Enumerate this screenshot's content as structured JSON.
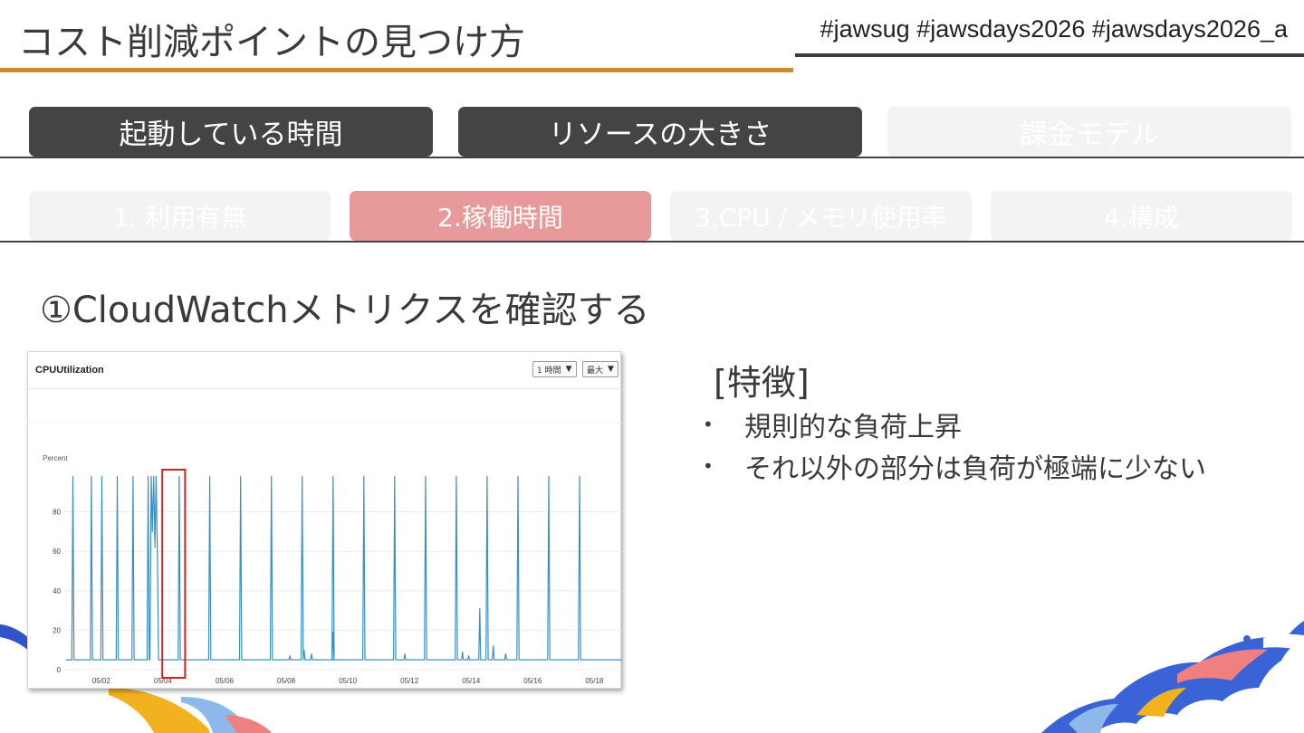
{
  "slide": {
    "title": "コスト削減ポイントの見つけ方",
    "hashtags": "#jawsug #jawsdays2026 #jawsdays2026_a"
  },
  "tabs": [
    {
      "label": "起動している時間",
      "active": true
    },
    {
      "label": "リソースの大きさ",
      "active": true
    },
    {
      "label": "課金モデル",
      "active": false
    }
  ],
  "steps": [
    {
      "label": "1. 利用有無",
      "active": false
    },
    {
      "label": "2.稼働時間",
      "active": true
    },
    {
      "label": "3.CPU / メモリ使用率",
      "active": false
    },
    {
      "label": "4.構成",
      "active": false
    }
  ],
  "section_heading": "①CloudWatchメトリクスを確認する",
  "metric_widget": {
    "title": "CPUUtilization",
    "period_select": "1 時間",
    "stat_select": "最大",
    "unit_label": "Percent"
  },
  "features": {
    "title": "[特徴]",
    "items": [
      "規則的な負荷上昇",
      "それ以外の部分は負荷が極端に少ない"
    ]
  },
  "colors": {
    "title_underline": "#c98b2c",
    "active_tab": "#444444",
    "active_step": "#e89a9a",
    "line_series": "#3b8fc4",
    "highlight_box": "#d42020"
  },
  "chart_data": {
    "type": "line",
    "title": "CPUUtilization",
    "ylabel": "Percent",
    "ylim": [
      0,
      100
    ],
    "y_ticks": [
      0,
      20,
      40,
      60,
      80
    ],
    "x_ticks": [
      "05/02",
      "05/04",
      "05/06",
      "05/08",
      "05/10",
      "05/12",
      "05/14",
      "05/16",
      "05/18"
    ],
    "x_tick_days": [
      2,
      4,
      6,
      8,
      10,
      12,
      14,
      16,
      18
    ],
    "xlim_days": [
      0.8,
      18.9
    ],
    "baseline": 5,
    "spikes": [
      {
        "day": 1.08,
        "value": 98
      },
      {
        "day": 1.68,
        "value": 98
      },
      {
        "day": 2.02,
        "value": 98
      },
      {
        "day": 2.52,
        "value": 98
      },
      {
        "day": 3.03,
        "value": 98
      },
      {
        "day": 3.52,
        "value": 98
      },
      {
        "day": 4.53,
        "value": 98
      },
      {
        "day": 5.52,
        "value": 98
      },
      {
        "day": 6.52,
        "value": 98
      },
      {
        "day": 7.52,
        "value": 98
      },
      {
        "day": 8.52,
        "value": 98
      },
      {
        "day": 9.52,
        "value": 98
      },
      {
        "day": 10.52,
        "value": 98
      },
      {
        "day": 11.52,
        "value": 98
      },
      {
        "day": 12.52,
        "value": 98
      },
      {
        "day": 13.52,
        "value": 98
      },
      {
        "day": 14.52,
        "value": 98
      },
      {
        "day": 15.52,
        "value": 98
      },
      {
        "day": 16.52,
        "value": 98
      },
      {
        "day": 17.52,
        "value": 98
      }
    ],
    "burst": [
      {
        "day": 3.58,
        "value": 5
      },
      {
        "day": 3.62,
        "value": 98
      },
      {
        "day": 3.66,
        "value": 70
      },
      {
        "day": 3.7,
        "value": 98
      },
      {
        "day": 3.74,
        "value": 62
      },
      {
        "day": 3.78,
        "value": 98
      },
      {
        "day": 3.82,
        "value": 60
      },
      {
        "day": 3.86,
        "value": 5
      }
    ],
    "bumps": [
      {
        "day": 8.12,
        "value": 7
      },
      {
        "day": 8.58,
        "value": 10
      },
      {
        "day": 8.82,
        "value": 8
      },
      {
        "day": 9.52,
        "value": 19
      },
      {
        "day": 11.85,
        "value": 8
      },
      {
        "day": 13.72,
        "value": 9
      },
      {
        "day": 13.92,
        "value": 7
      },
      {
        "day": 14.28,
        "value": 31
      },
      {
        "day": 14.72,
        "value": 12
      },
      {
        "day": 15.12,
        "value": 8
      }
    ],
    "highlight_range_days": [
      3.98,
      4.72
    ]
  }
}
